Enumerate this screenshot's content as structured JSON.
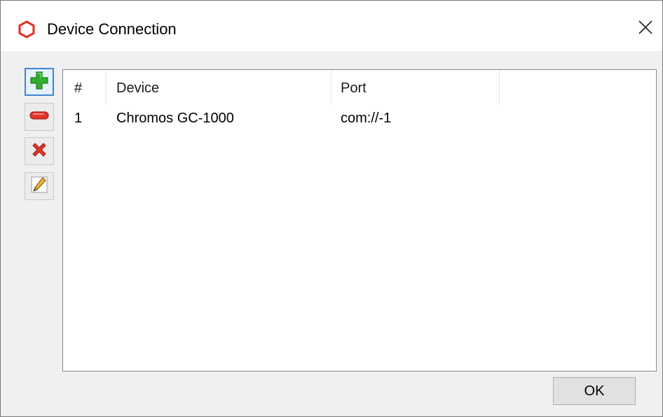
{
  "window": {
    "title": "Device Connection",
    "app_icon": "hexagon-logo-icon",
    "close_icon": "close-icon"
  },
  "toolbar": {
    "buttons": [
      {
        "icon": "add-icon",
        "selected": true
      },
      {
        "icon": "remove-icon",
        "selected": false
      },
      {
        "icon": "delete-icon",
        "selected": false
      },
      {
        "icon": "edit-icon",
        "selected": false
      }
    ]
  },
  "list": {
    "columns": [
      "#",
      "Device",
      "Port",
      ""
    ],
    "rows": [
      {
        "num": "1",
        "device": "Chromos GC-1000",
        "port": "com://-1"
      }
    ]
  },
  "footer": {
    "ok_label": "OK"
  },
  "colors": {
    "accent": "#3b87d6",
    "icon_red": "#e0352b",
    "icon_green": "#2fae2f"
  }
}
